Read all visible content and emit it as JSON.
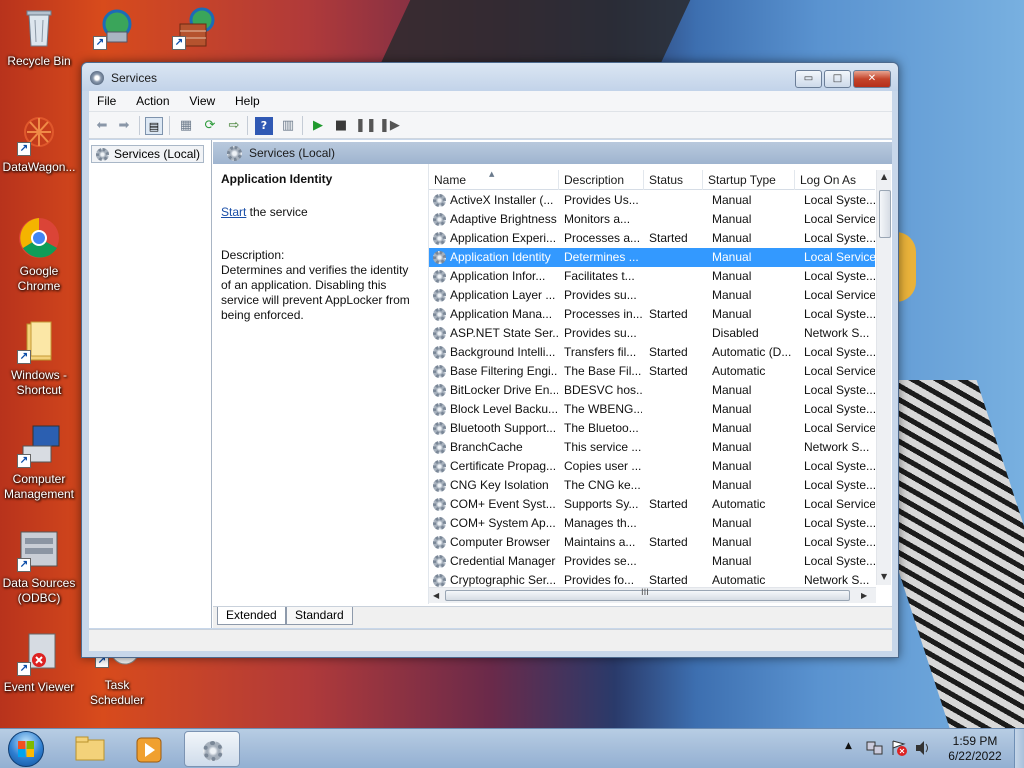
{
  "desktop": {
    "icons": [
      {
        "label": "Recycle Bin",
        "icon": "recycle-bin-icon"
      },
      {
        "label": "",
        "icon": "network-globe-icon"
      },
      {
        "label": "",
        "icon": "firewall-globe-icon"
      },
      {
        "label": "DataWagon...",
        "icon": "datawagon-icon"
      },
      {
        "label": "Google Chrome",
        "icon": "chrome-icon"
      },
      {
        "label": "Windows - Shortcut",
        "icon": "folder-icon"
      },
      {
        "label": "Computer Management",
        "icon": "computer-management-icon"
      },
      {
        "label": "Data Sources (ODBC)",
        "icon": "data-sources-icon"
      },
      {
        "label": "Event Viewer",
        "icon": "event-viewer-icon"
      },
      {
        "label": "Task Scheduler",
        "icon": "task-scheduler-icon"
      }
    ]
  },
  "window": {
    "title": "Services",
    "buttons": {
      "minimize": "▭",
      "maximize": "□",
      "close": "✕"
    },
    "menu": [
      "File",
      "Action",
      "View",
      "Help"
    ],
    "tree_item": "Services (Local)",
    "header": "Services (Local)",
    "details": {
      "title": "Application Identity",
      "start_link": "Start",
      "start_rest": " the service",
      "desc_label": "Description:",
      "desc_text": "Determines and verifies the identity of an application. Disabling this service will prevent AppLocker from being enforced."
    },
    "columns": [
      "Name",
      "Description",
      "Status",
      "Startup Type",
      "Log On As"
    ],
    "rows": [
      {
        "name": "ActiveX Installer (...",
        "desc": "Provides Us...",
        "status": "",
        "startup": "Manual",
        "logon": "Local Syste..."
      },
      {
        "name": "Adaptive Brightness",
        "desc": "Monitors a...",
        "status": "",
        "startup": "Manual",
        "logon": "Local Service"
      },
      {
        "name": "Application Experi...",
        "desc": "Processes a...",
        "status": "Started",
        "startup": "Manual",
        "logon": "Local Syste..."
      },
      {
        "name": "Application Identity",
        "desc": "Determines ...",
        "status": "",
        "startup": "Manual",
        "logon": "Local Service",
        "selected": true
      },
      {
        "name": "Application Infor...",
        "desc": "Facilitates t...",
        "status": "",
        "startup": "Manual",
        "logon": "Local Syste..."
      },
      {
        "name": "Application Layer ...",
        "desc": "Provides su...",
        "status": "",
        "startup": "Manual",
        "logon": "Local Service"
      },
      {
        "name": "Application Mana...",
        "desc": "Processes in...",
        "status": "Started",
        "startup": "Manual",
        "logon": "Local Syste..."
      },
      {
        "name": "ASP.NET State Ser...",
        "desc": "Provides su...",
        "status": "",
        "startup": "Disabled",
        "logon": "Network S..."
      },
      {
        "name": "Background Intelli...",
        "desc": "Transfers fil...",
        "status": "Started",
        "startup": "Automatic (D...",
        "logon": "Local Syste..."
      },
      {
        "name": "Base Filtering Engi...",
        "desc": "The Base Fil...",
        "status": "Started",
        "startup": "Automatic",
        "logon": "Local Service"
      },
      {
        "name": "BitLocker Drive En...",
        "desc": "BDESVC hos...",
        "status": "",
        "startup": "Manual",
        "logon": "Local Syste..."
      },
      {
        "name": "Block Level Backu...",
        "desc": "The WBENG...",
        "status": "",
        "startup": "Manual",
        "logon": "Local Syste..."
      },
      {
        "name": "Bluetooth Support...",
        "desc": "The Bluetoo...",
        "status": "",
        "startup": "Manual",
        "logon": "Local Service"
      },
      {
        "name": "BranchCache",
        "desc": "This service ...",
        "status": "",
        "startup": "Manual",
        "logon": "Network S..."
      },
      {
        "name": "Certificate Propag...",
        "desc": "Copies user ...",
        "status": "",
        "startup": "Manual",
        "logon": "Local Syste..."
      },
      {
        "name": "CNG Key Isolation",
        "desc": "The CNG ke...",
        "status": "",
        "startup": "Manual",
        "logon": "Local Syste..."
      },
      {
        "name": "COM+ Event Syst...",
        "desc": "Supports Sy...",
        "status": "Started",
        "startup": "Automatic",
        "logon": "Local Service"
      },
      {
        "name": "COM+ System Ap...",
        "desc": "Manages th...",
        "status": "",
        "startup": "Manual",
        "logon": "Local Syste..."
      },
      {
        "name": "Computer Browser",
        "desc": "Maintains a...",
        "status": "Started",
        "startup": "Manual",
        "logon": "Local Syste..."
      },
      {
        "name": "Credential Manager",
        "desc": "Provides se...",
        "status": "",
        "startup": "Manual",
        "logon": "Local Syste..."
      },
      {
        "name": "Cryptographic Ser...",
        "desc": "Provides fo...",
        "status": "Started",
        "startup": "Automatic",
        "logon": "Network S..."
      }
    ],
    "tabs": [
      "Extended",
      "Standard"
    ],
    "hscroll_label": "III"
  },
  "taskbar": {
    "clock_time": "1:59 PM",
    "clock_date": "6/22/2022"
  }
}
